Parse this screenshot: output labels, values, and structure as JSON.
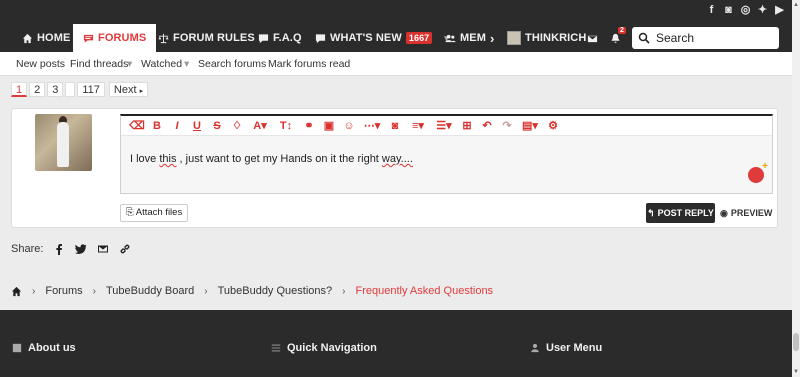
{
  "nav": {
    "home": "HOME",
    "forums": "FORUMS",
    "forum_rules": "FORUM RULES",
    "faq": "F.A.Q",
    "whats_new": "WHAT'S NEW",
    "whats_new_count": "1667",
    "members": "MEM",
    "username": "THINKRICH",
    "alerts_count": "2",
    "search_placeholder": "Search"
  },
  "subnav": {
    "new_posts": "New posts",
    "find_threads": "Find threads",
    "watched": "Watched",
    "search_forums": "Search forums",
    "mark_read": "Mark forums read"
  },
  "pager": {
    "pages": [
      "1",
      "2",
      "3"
    ],
    "last": "117",
    "next": "Next"
  },
  "editor": {
    "text_before": "I love ",
    "text_u1": "this",
    "text_mid": " , just want to get my Hands on it the right ",
    "text_u2": "way....",
    "attach": "Attach files",
    "post_reply": "POST REPLY",
    "preview": "PREVIEW"
  },
  "share": {
    "label": "Share:"
  },
  "breadcrumb": {
    "items": [
      "Forums",
      "TubeBuddy Board",
      "TubeBuddy Questions?"
    ],
    "current": "Frequently Asked Questions"
  },
  "footer": {
    "about": "About us",
    "quick_nav": "Quick Navigation",
    "user_menu": "User Menu"
  },
  "colors": {
    "accent": "#e03b3b",
    "dark": "#2b2b2b"
  }
}
